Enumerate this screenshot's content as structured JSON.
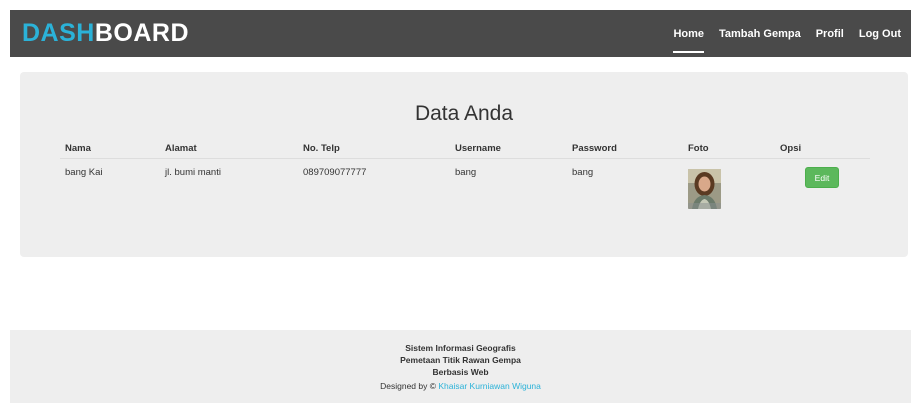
{
  "brand": {
    "part1": "DASH",
    "part2": "BOARD"
  },
  "nav": {
    "items": [
      {
        "label": "Home"
      },
      {
        "label": "Tambah Gempa"
      },
      {
        "label": "Profil"
      },
      {
        "label": "Log Out"
      }
    ]
  },
  "main": {
    "title": "Data Anda",
    "columns": [
      "Nama",
      "Alamat",
      "No. Telp",
      "Username",
      "Password",
      "Foto",
      "Opsi"
    ],
    "row": {
      "nama": "bang Kai",
      "alamat": "jl. bumi manti",
      "telp": "089709077777",
      "username": "bang",
      "password": "bang",
      "edit_label": "Edit"
    }
  },
  "footer": {
    "line1": "Sistem Informasi Geografis",
    "line2": "Pemetaan Titik Rawan Gempa",
    "line3": "Berbasis Web",
    "credit_prefix": "Designed by © ",
    "credit_name": "Khaisar Kurniawan Wiguna"
  },
  "colors": {
    "navbar": "#4a4a4a",
    "brand_accent": "#2bb2d8",
    "card_bg": "#eeeeee",
    "button_success": "#5cb85c"
  }
}
